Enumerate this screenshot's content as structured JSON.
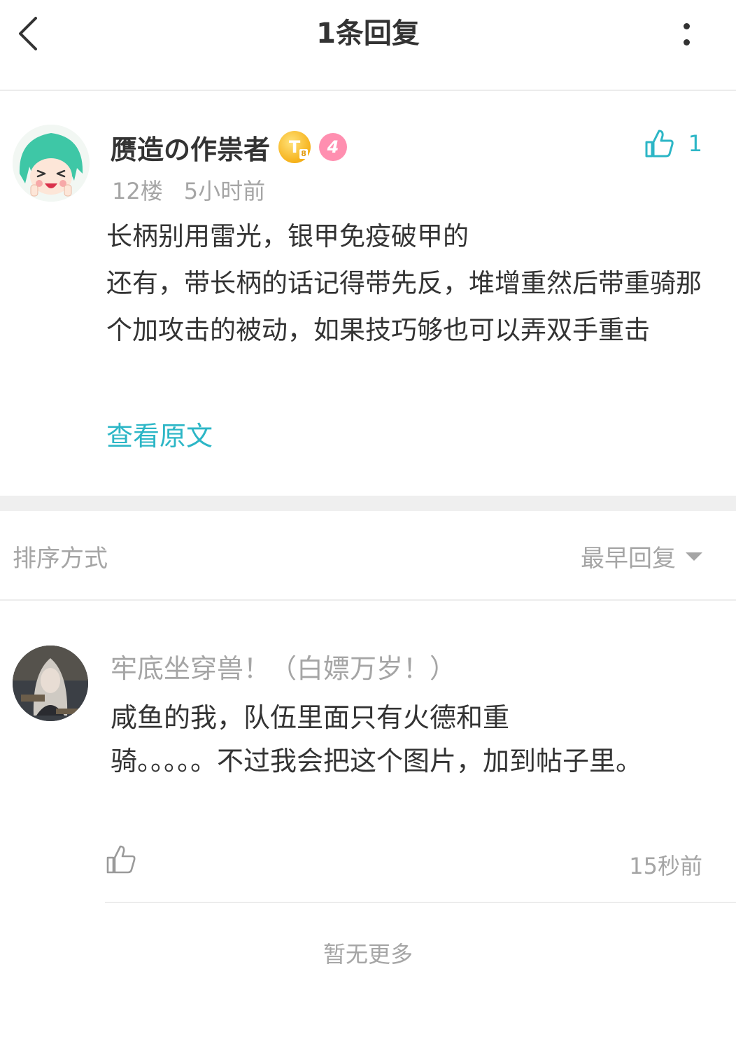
{
  "header": {
    "title": "1条回复"
  },
  "post": {
    "author": "赝造の作祟者",
    "badge_t": "T",
    "badge_t_sub": "8",
    "level": "4",
    "like_count": "1",
    "floor": "12楼",
    "time": "5小时前",
    "body_lines": [
      "长柄别用雷光，银甲免疫破甲的",
      "还有，带长柄的话记得带先反，堆增重然后带重骑那个加攻击的被动，如果技巧够也可以弄双手重击"
    ],
    "view_original": "查看原文"
  },
  "sort": {
    "label": "排序方式",
    "selected": "最早回复"
  },
  "reply": {
    "author": "牢底坐穿兽！（白嫖万岁！）",
    "body_lines": [
      "咸鱼的我，队伍里面只有火德和重",
      "骑。。。。。不过我会把这个图片，加到帖子里。"
    ],
    "time": "15秒前"
  },
  "footer": {
    "no_more": "暂无更多"
  },
  "colors": {
    "accent": "#2cb6c6",
    "muted": "#a5a5a5",
    "text": "#333333",
    "divider": "#ececec"
  },
  "icons": {
    "back": "chevron-left-icon",
    "more": "more-vertical-icon",
    "like_filled": "thumbs-up-icon",
    "like_outline": "thumbs-up-outline-icon",
    "caret": "caret-down-icon"
  }
}
